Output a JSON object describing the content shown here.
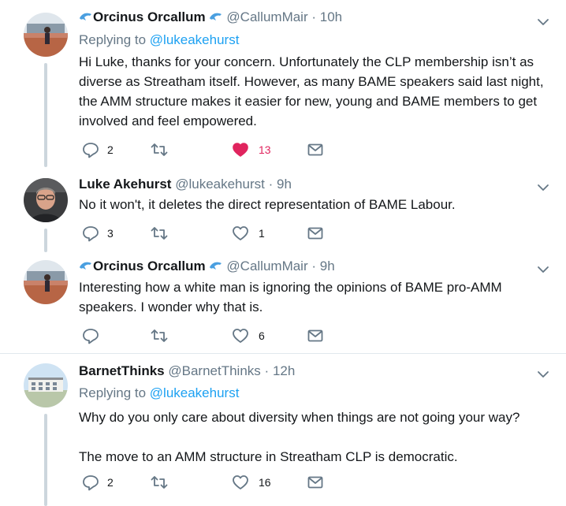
{
  "tweets": [
    {
      "name": "Orcinus Orcallum",
      "handle": "@CallumMair",
      "time": "10h",
      "replying_prefix": "Replying to ",
      "replying_to": "@lukeakehurst",
      "lines": [
        "Hi Luke, thanks for your concern. Unfortunately the CLP membership isn’t as",
        "diverse as Streatham itself. However, as many BAME speakers said last night,",
        "the AMM structure makes it easier for new, young and BAME members to get",
        "involved and feel empowered."
      ],
      "replies": "2",
      "retweets": "",
      "likes": "13",
      "liked": true
    },
    {
      "name": "Luke Akehurst",
      "handle": "@lukeakehurst",
      "time": "9h",
      "lines": [
        "No it won't, it deletes the direct representation of BAME Labour."
      ],
      "replies": "3",
      "retweets": "",
      "likes": "1",
      "liked": false
    },
    {
      "name": "Orcinus Orcallum",
      "handle": "@CallumMair",
      "time": "9h",
      "lines": [
        "Interesting how a white man is ignoring the opinions of BAME pro-AMM",
        "speakers. I wonder why that is."
      ],
      "replies": "",
      "retweets": "",
      "likes": "6",
      "liked": false
    },
    {
      "name": "BarnetThinks",
      "handle": "@BarnetThinks",
      "time": "12h",
      "replying_prefix": "Replying to ",
      "replying_to": "@lukeakehurst",
      "lines": [
        "Why do you only care about diversity when things are not going your way?",
        "The move to an AMM structure in Streatham CLP is democratic."
      ],
      "replies": "2",
      "retweets": "",
      "likes": "16",
      "liked": false
    }
  ],
  "dot": "·",
  "colors": {
    "accent": "#1da1f2",
    "muted": "#657786",
    "like": "#e0245e",
    "divider": "#e1e8ed"
  },
  "icons": [
    "dolphin-emoji-icon",
    "chevron-down-icon",
    "reply-icon",
    "retweet-icon",
    "heart-icon",
    "message-icon"
  ]
}
